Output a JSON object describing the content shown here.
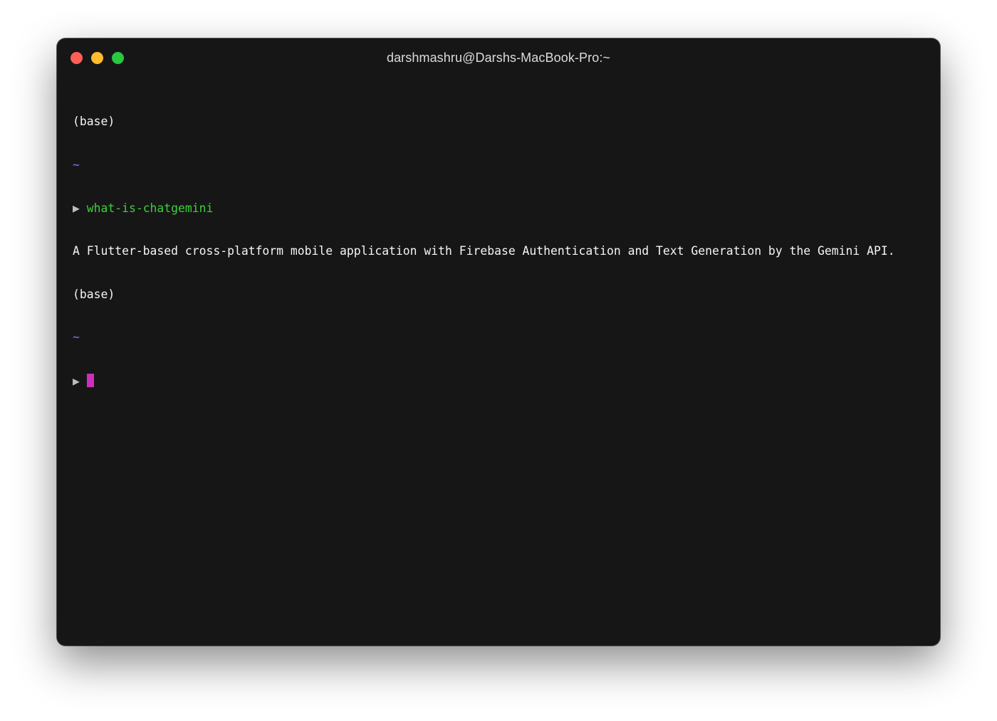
{
  "window": {
    "title": "darshmashru@Darshs-MacBook-Pro:~"
  },
  "colors": {
    "background": "#161616",
    "text": "#f5f5f5",
    "tilde": "#7b7bf2",
    "command": "#3ccf3c",
    "cursor": "#cf2fbf",
    "close": "#ff5f57",
    "minimize": "#febc2e",
    "zoom": "#28c840"
  },
  "terminal": {
    "line1": "(base)",
    "line2": "~",
    "line3_prompt": "▶ ",
    "line3_command": "what-is-chatgemini",
    "line4": "A Flutter-based cross-platform mobile application with Firebase Authentication and Text Generation by the Gemini API.",
    "line5": "(base)",
    "line6": "~",
    "line7_prompt": "▶ "
  }
}
